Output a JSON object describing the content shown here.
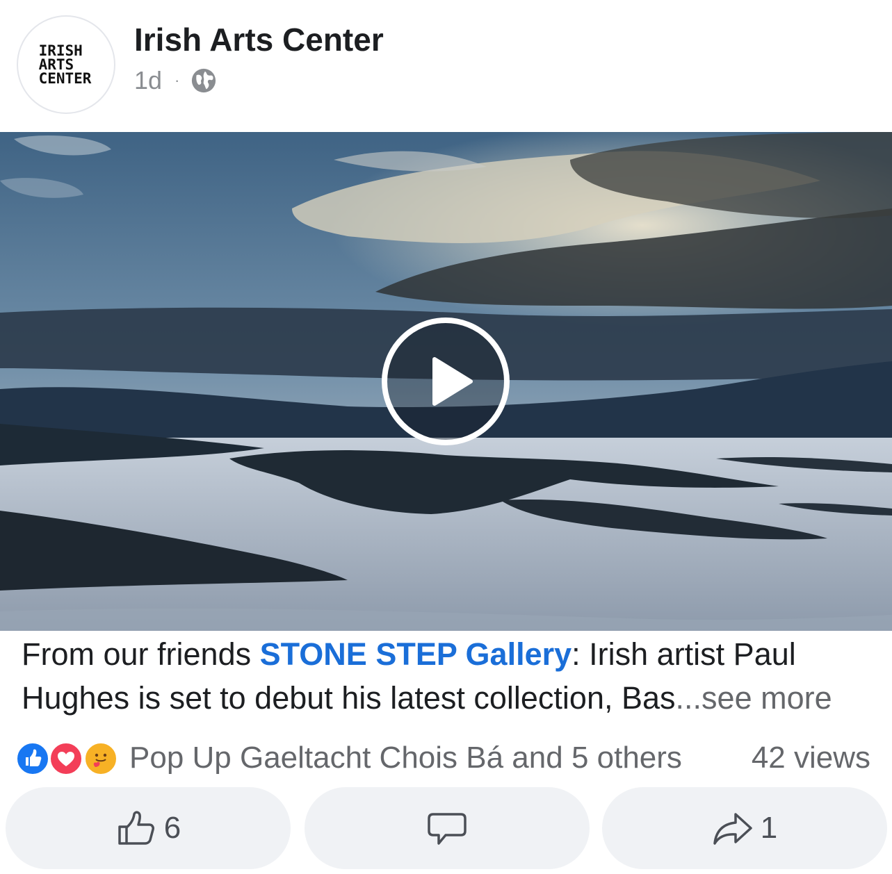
{
  "post": {
    "page_name": "Irish Arts Center",
    "avatar_text": "IRISH\nARTS\nCENTER",
    "timestamp": "1d",
    "separator": "·",
    "privacy_icon": "globe-icon"
  },
  "video": {
    "play_icon": "play-icon"
  },
  "caption": {
    "prefix": "From our friends ",
    "link_text": "STONE STEP Gallery",
    "body": ": Irish artist Paul Hughes is set to debut his latest collection, Bas",
    "see_more": "...see more"
  },
  "reactions": {
    "icons": [
      "like-reaction-icon",
      "love-reaction-icon",
      "care-reaction-icon"
    ],
    "reactors_text": "Pop Up Gaeltacht Chois Bá and 5 others",
    "views_text": "42 views"
  },
  "actions": {
    "like_count": "6",
    "share_count": "1"
  },
  "colors": {
    "link": "#1a6ed8",
    "like_blue": "#1877f2",
    "love_red": "#f33e58",
    "care_yellow": "#f7b125",
    "button_bg": "#f0f2f5"
  }
}
